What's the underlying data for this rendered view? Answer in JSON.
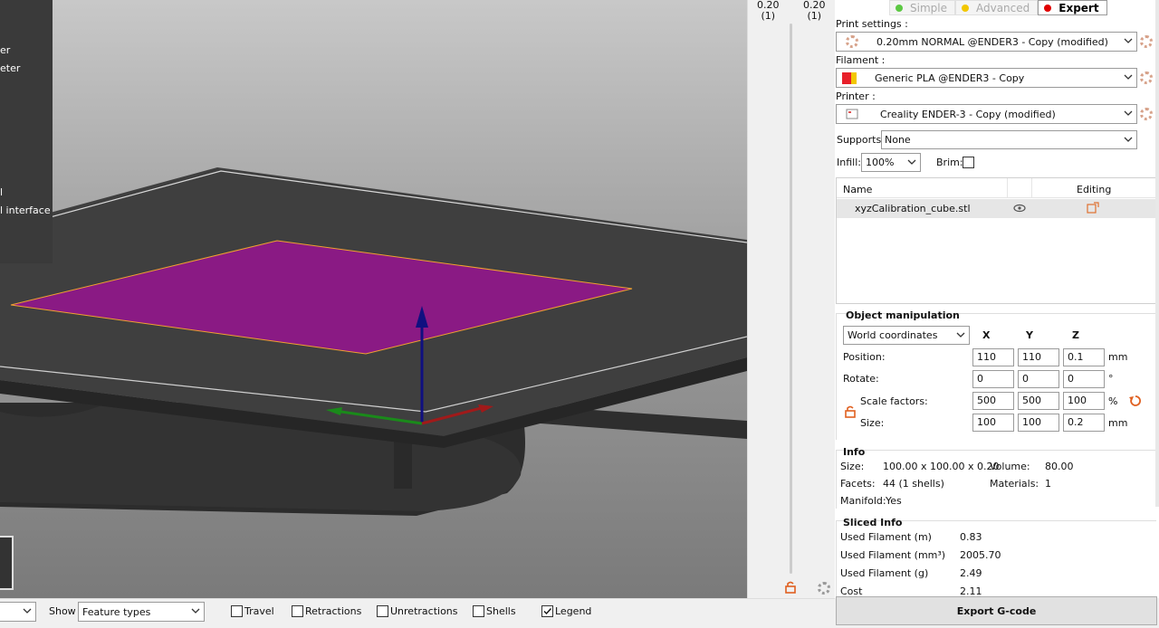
{
  "legend_lines": [
    "er",
    "eter",
    "l",
    "l interface"
  ],
  "slider": {
    "top_left": "0.20",
    "top_left_sub": "(1)",
    "top_right": "0.20",
    "top_right_sub": "(1)"
  },
  "modes": [
    {
      "label": "Simple",
      "color": "#5cc843"
    },
    {
      "label": "Advanced",
      "color": "#f2c700"
    },
    {
      "label": "Expert",
      "color": "#e00000"
    }
  ],
  "print_settings": {
    "label": "Print settings :",
    "value": "0.20mm NORMAL @ENDER3 - Copy (modified)"
  },
  "filament": {
    "label": "Filament :",
    "value": "Generic PLA @ENDER3 - Copy",
    "colors": [
      "#e8202a",
      "#f2c700"
    ]
  },
  "printer": {
    "label": "Printer :",
    "value": "Creality ENDER-3 - Copy (modified)"
  },
  "supports": {
    "label": "Supports:",
    "value": "None"
  },
  "infill": {
    "label": "Infill:",
    "value": "100%"
  },
  "brim": {
    "label": "Brim:"
  },
  "object_list": {
    "col_name": "Name",
    "col_editing": "Editing",
    "rows": [
      {
        "name": "xyzCalibration_cube.stl"
      }
    ]
  },
  "object_manipulation": {
    "title": "Object manipulation",
    "coord_system": "World coordinates",
    "axes": [
      "X",
      "Y",
      "Z"
    ],
    "rows": [
      {
        "label": "Position:",
        "x": "110",
        "y": "110",
        "z": "0.1",
        "unit": "mm"
      },
      {
        "label": "Rotate:",
        "x": "0",
        "y": "0",
        "z": "0",
        "unit": "°"
      },
      {
        "label": "Scale factors:",
        "x": "500",
        "y": "500",
        "z": "100",
        "unit": "%"
      },
      {
        "label": "Size:",
        "x": "100",
        "y": "100",
        "z": "0.2",
        "unit": "mm"
      }
    ]
  },
  "info": {
    "title": "Info",
    "size_label": "Size:",
    "size": "100.00 x 100.00 x 0.20",
    "volume_label": "Volume:",
    "volume": "80.00",
    "facets_label": "Facets:",
    "facets": "44 (1 shells)",
    "materials_label": "Materials:",
    "materials": "1",
    "manifold_label": "Manifold:",
    "manifold": "Yes"
  },
  "sliced_info": {
    "title": "Sliced Info",
    "rows": [
      {
        "label": "Used Filament (m)",
        "value": "0.83"
      },
      {
        "label": "Used Filament (mm³)",
        "value": "2005.70"
      },
      {
        "label": "Used Filament (g)",
        "value": "2.49"
      },
      {
        "label": "Cost",
        "value": "2.11"
      }
    ]
  },
  "bottom_bar": {
    "show_label": "Show",
    "view_value": "Feature types",
    "checks": [
      {
        "label": "Travel",
        "checked": false
      },
      {
        "label": "Retractions",
        "checked": false
      },
      {
        "label": "Unretractions",
        "checked": false
      },
      {
        "label": "Shells",
        "checked": false
      },
      {
        "label": "Legend",
        "checked": true
      }
    ]
  },
  "export_label": "Export G-code"
}
